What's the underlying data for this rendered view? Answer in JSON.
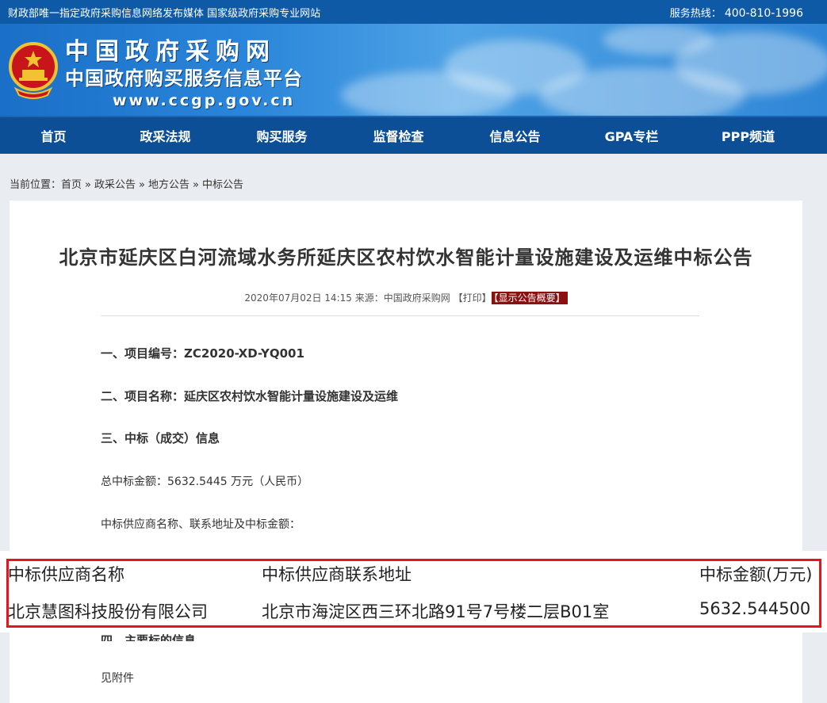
{
  "topbar": {
    "tagline": "财政部唯一指定政府采购信息网络发布媒体 国家级政府采购专业网站",
    "hotline_label": "服务热线：",
    "hotline_number": "400-810-1996"
  },
  "banner": {
    "title_cn": "中国政府采购网",
    "subtitle_cn": "中国政府购买服务信息平台",
    "url": "www.ccgp.gov.cn"
  },
  "nav": {
    "items": [
      "首页",
      "政采法规",
      "购买服务",
      "监督检查",
      "信息公告",
      "GPA专栏",
      "PPP频道"
    ]
  },
  "breadcrumb": {
    "prefix": "当前位置：",
    "items": [
      "首页",
      "政采公告",
      "地方公告",
      "中标公告"
    ],
    "separator": "»"
  },
  "article": {
    "title": "北京市延庆区白河流域水务所延庆区农村饮水智能计量设施建设及运维中标公告",
    "meta_date": "2020年07月02日 14:15",
    "meta_source": "来源：中国政府采购网",
    "print_label": "【打印】",
    "overview_label": "【显示公告概要】",
    "sections": {
      "s1": "一、项目编号：ZC2020-XD-YQ001",
      "s2": "二、项目名称：延庆区农村饮水智能计量设施建设及运维",
      "s3": "三、中标（成交）信息",
      "total_amount": "总中标金额：5632.5445 万元（人民币）",
      "supplier_intro": "中标供应商名称、联系地址及中标金额：",
      "s4": "四、主要标的信息",
      "attachment": "见附件"
    }
  },
  "winner_table": {
    "headers": [
      "中标供应商名称",
      "中标供应商联系地址",
      "中标金额(万元)"
    ],
    "row": [
      "北京慧图科技股份有限公司",
      "北京市海淀区西三环北路91号7号楼二层B01室",
      "5632.544500"
    ]
  },
  "colors": {
    "topbar": "#0e5aa6",
    "nav": "#0c4f96",
    "highlight_border": "#e8141a",
    "overview_button": "#8b1010"
  }
}
